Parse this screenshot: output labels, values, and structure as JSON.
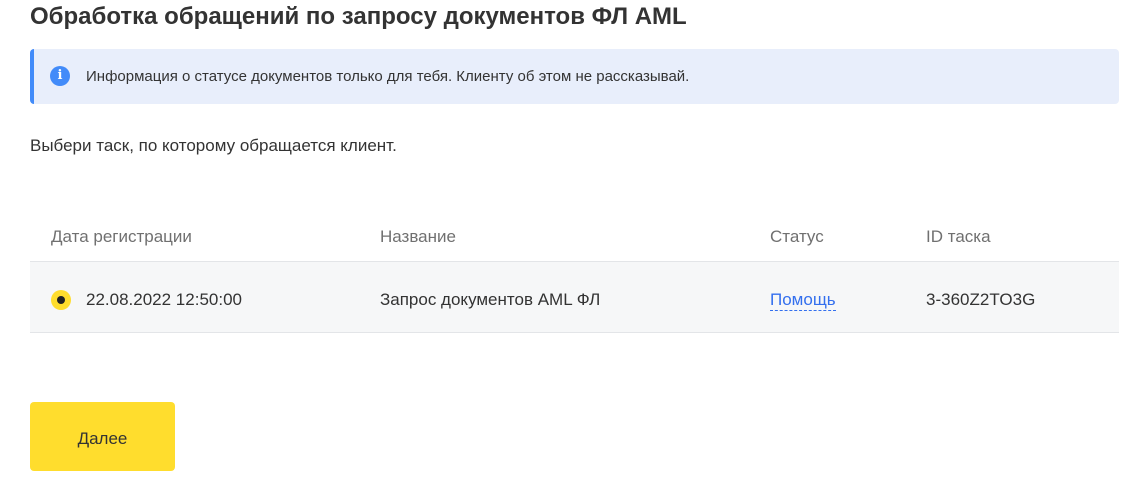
{
  "page": {
    "title": "Обработка обращений по запросу документов ФЛ AML"
  },
  "info_banner": {
    "icon": "info-icon",
    "text": "Информация о статусе документов только для тебя. Клиенту об этом не рассказывай.",
    "accent_color": "#428bf9",
    "background_color": "#e8eefb"
  },
  "prompt": "Выбери таск, по которому обращается клиент.",
  "table": {
    "columns": [
      "Дата регистрации",
      "Название",
      "Статус",
      "ID таска"
    ],
    "rows": [
      {
        "selected": true,
        "date": "22.08.2022 12:50:00",
        "name": "Запрос документов AML ФЛ",
        "status": "Помощь",
        "task_id": "3-360Z2TO3G"
      }
    ]
  },
  "next_button": {
    "label": "Далее",
    "color": "#ffdd2d"
  }
}
